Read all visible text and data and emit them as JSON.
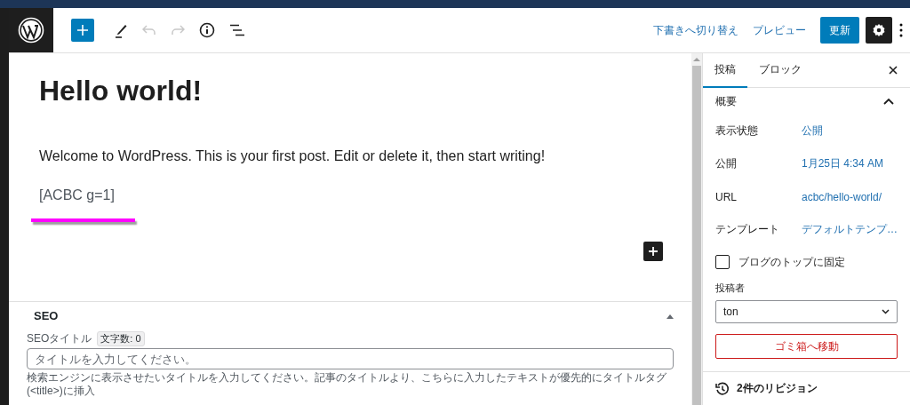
{
  "toolbar": {
    "links": [
      {
        "label": "下書きへ切り替え"
      },
      {
        "label": "プレビュー"
      }
    ],
    "update_button": "更新"
  },
  "post": {
    "title": "Hello world!",
    "paragraphs": [
      "Welcome to WordPress. This is your first post. Edit or delete it, then start writing!",
      "[ACBC g=1]"
    ]
  },
  "seo": {
    "heading": "SEO",
    "expanded": true,
    "field_label": "SEOタイトル",
    "char_count": "文字数: 0",
    "placeholder": "タイトルを入力してください。",
    "help": "検索エンジンに表示させたいタイトルを入力してください。記事のタイトルより、こちらに入力したテキストが優先的にタイトルタグ(<title>)に挿入"
  },
  "sidebar": {
    "tabs": [
      {
        "label": "投稿",
        "selected": true
      },
      {
        "label": "ブロック",
        "selected": false
      }
    ],
    "panel": {
      "title": "概要",
      "expanded": true,
      "rows": [
        {
          "label": "表示状態",
          "value": "公開"
        },
        {
          "label": "公開",
          "value": "1月25日 4:34 AM"
        },
        {
          "label": "URL",
          "value": "acbc/hello-world/"
        },
        {
          "label": "テンプレート",
          "value": "デフォルトテンプ…"
        }
      ],
      "sticky": {
        "label": "ブログのトップに固定",
        "checked": false
      },
      "author_label": "投稿者",
      "author": "ton",
      "trash_button": "ゴミ箱へ移動"
    },
    "revisions": "2件のリビジョン"
  }
}
